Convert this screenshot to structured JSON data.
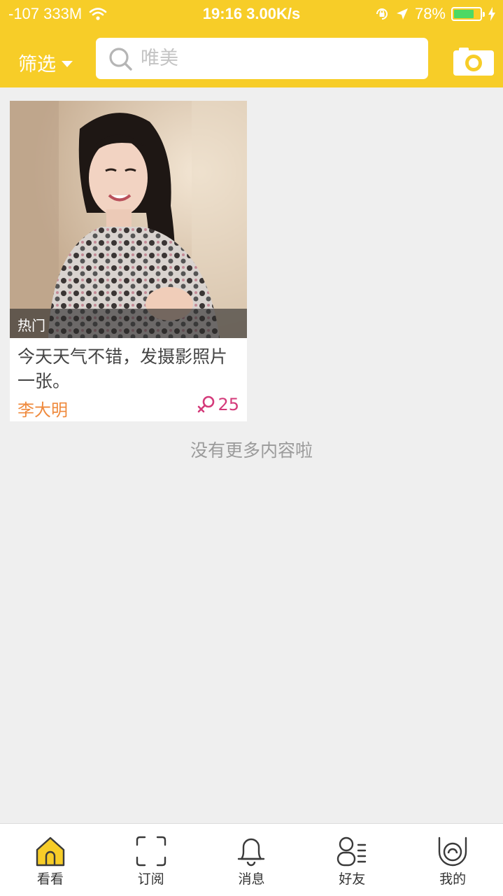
{
  "status_bar": {
    "carrier": "-107 333M",
    "time_speed": "19:16 3.00K/s",
    "battery_pct": "78%",
    "battery_level": 0.78,
    "battery_color": "#4cd964"
  },
  "header": {
    "filter_label": "筛选",
    "search_placeholder": "唯美",
    "search_value": "",
    "camera_icon": "camera-icon",
    "accent_color": "#f7cd28"
  },
  "feed": {
    "items": [
      {
        "tag": "热门",
        "caption": "今天天气不错，发摄影照片一张。",
        "author": "李大明",
        "gender_icon": "female-icon",
        "age": "25"
      }
    ],
    "end_text": "没有更多内容啦"
  },
  "tabbar": {
    "tabs": [
      {
        "label": "看看",
        "icon": "home-icon",
        "active": true
      },
      {
        "label": "订阅",
        "icon": "scan-frame-icon",
        "active": false
      },
      {
        "label": "消息",
        "icon": "bell-icon",
        "active": false
      },
      {
        "label": "好友",
        "icon": "friends-icon",
        "active": false
      },
      {
        "label": "我的",
        "icon": "profile-icon",
        "active": false
      }
    ]
  }
}
